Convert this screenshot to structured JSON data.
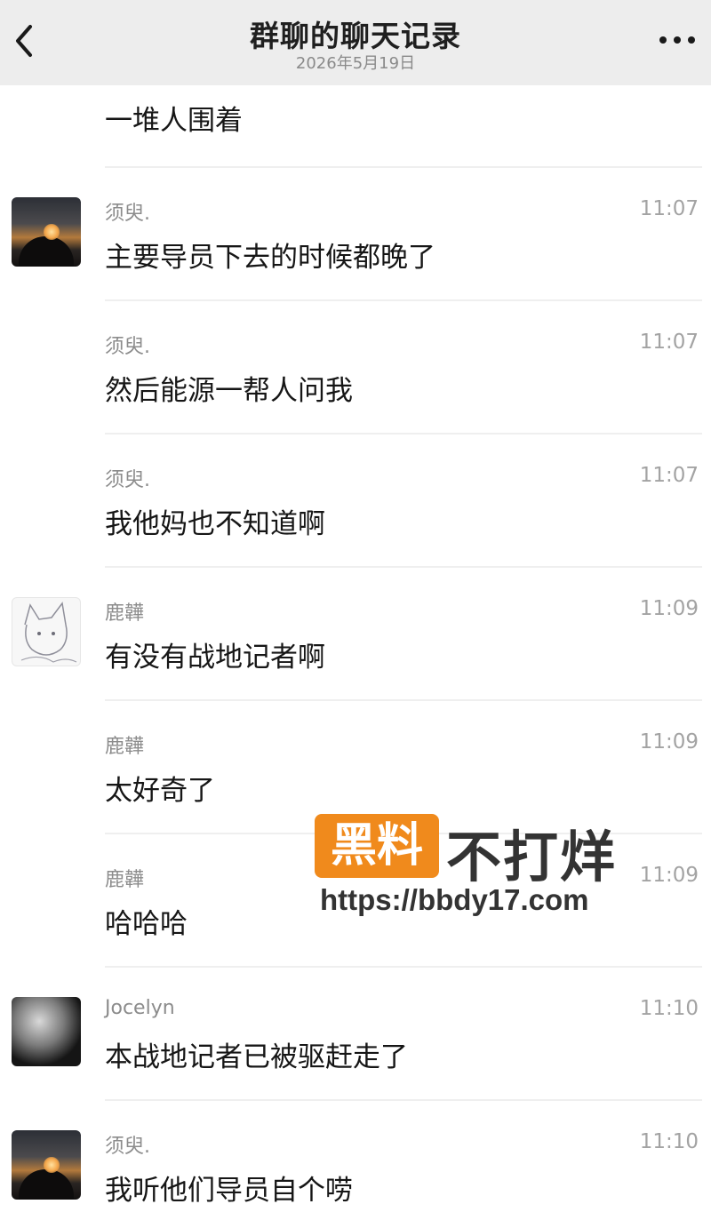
{
  "header": {
    "title": "群聊的聊天记录",
    "date": "2026年5月19日",
    "back_icon": "chevron-left-icon",
    "more_icon": "ellipsis-icon"
  },
  "first_message": {
    "text": "一堆人围着"
  },
  "messages": [
    {
      "sender": "须臾.",
      "time": "11:07",
      "text": "主要导员下去的时候都晚了",
      "avatar": "sunset-photo"
    },
    {
      "sender": "须臾.",
      "time": "11:07",
      "text": "然后能源一帮人问我",
      "avatar": ""
    },
    {
      "sender": "须臾.",
      "time": "11:07",
      "text": "我他妈也不知道啊",
      "avatar": ""
    },
    {
      "sender": "鹿韡",
      "time": "11:09",
      "text": "有没有战地记者啊",
      "avatar": "sketch-cat-drawing"
    },
    {
      "sender": "鹿韡",
      "time": "11:09",
      "text": "太好奇了",
      "avatar": ""
    },
    {
      "sender": "鹿韡",
      "time": "11:09",
      "text": "哈哈哈",
      "avatar": ""
    },
    {
      "sender": "Jocelyn",
      "time": "11:10",
      "text": "本战地记者已被驱赶走了",
      "avatar": "monochrome-portrait"
    },
    {
      "sender": "须臾.",
      "time": "11:10",
      "text": "我听他们导员自个唠",
      "avatar": "sunset-photo"
    }
  ],
  "watermark": {
    "badge_text": "黑料",
    "text": "不打烊",
    "url": "https://bbdy17.com",
    "badge_color": "#f08a1c"
  }
}
